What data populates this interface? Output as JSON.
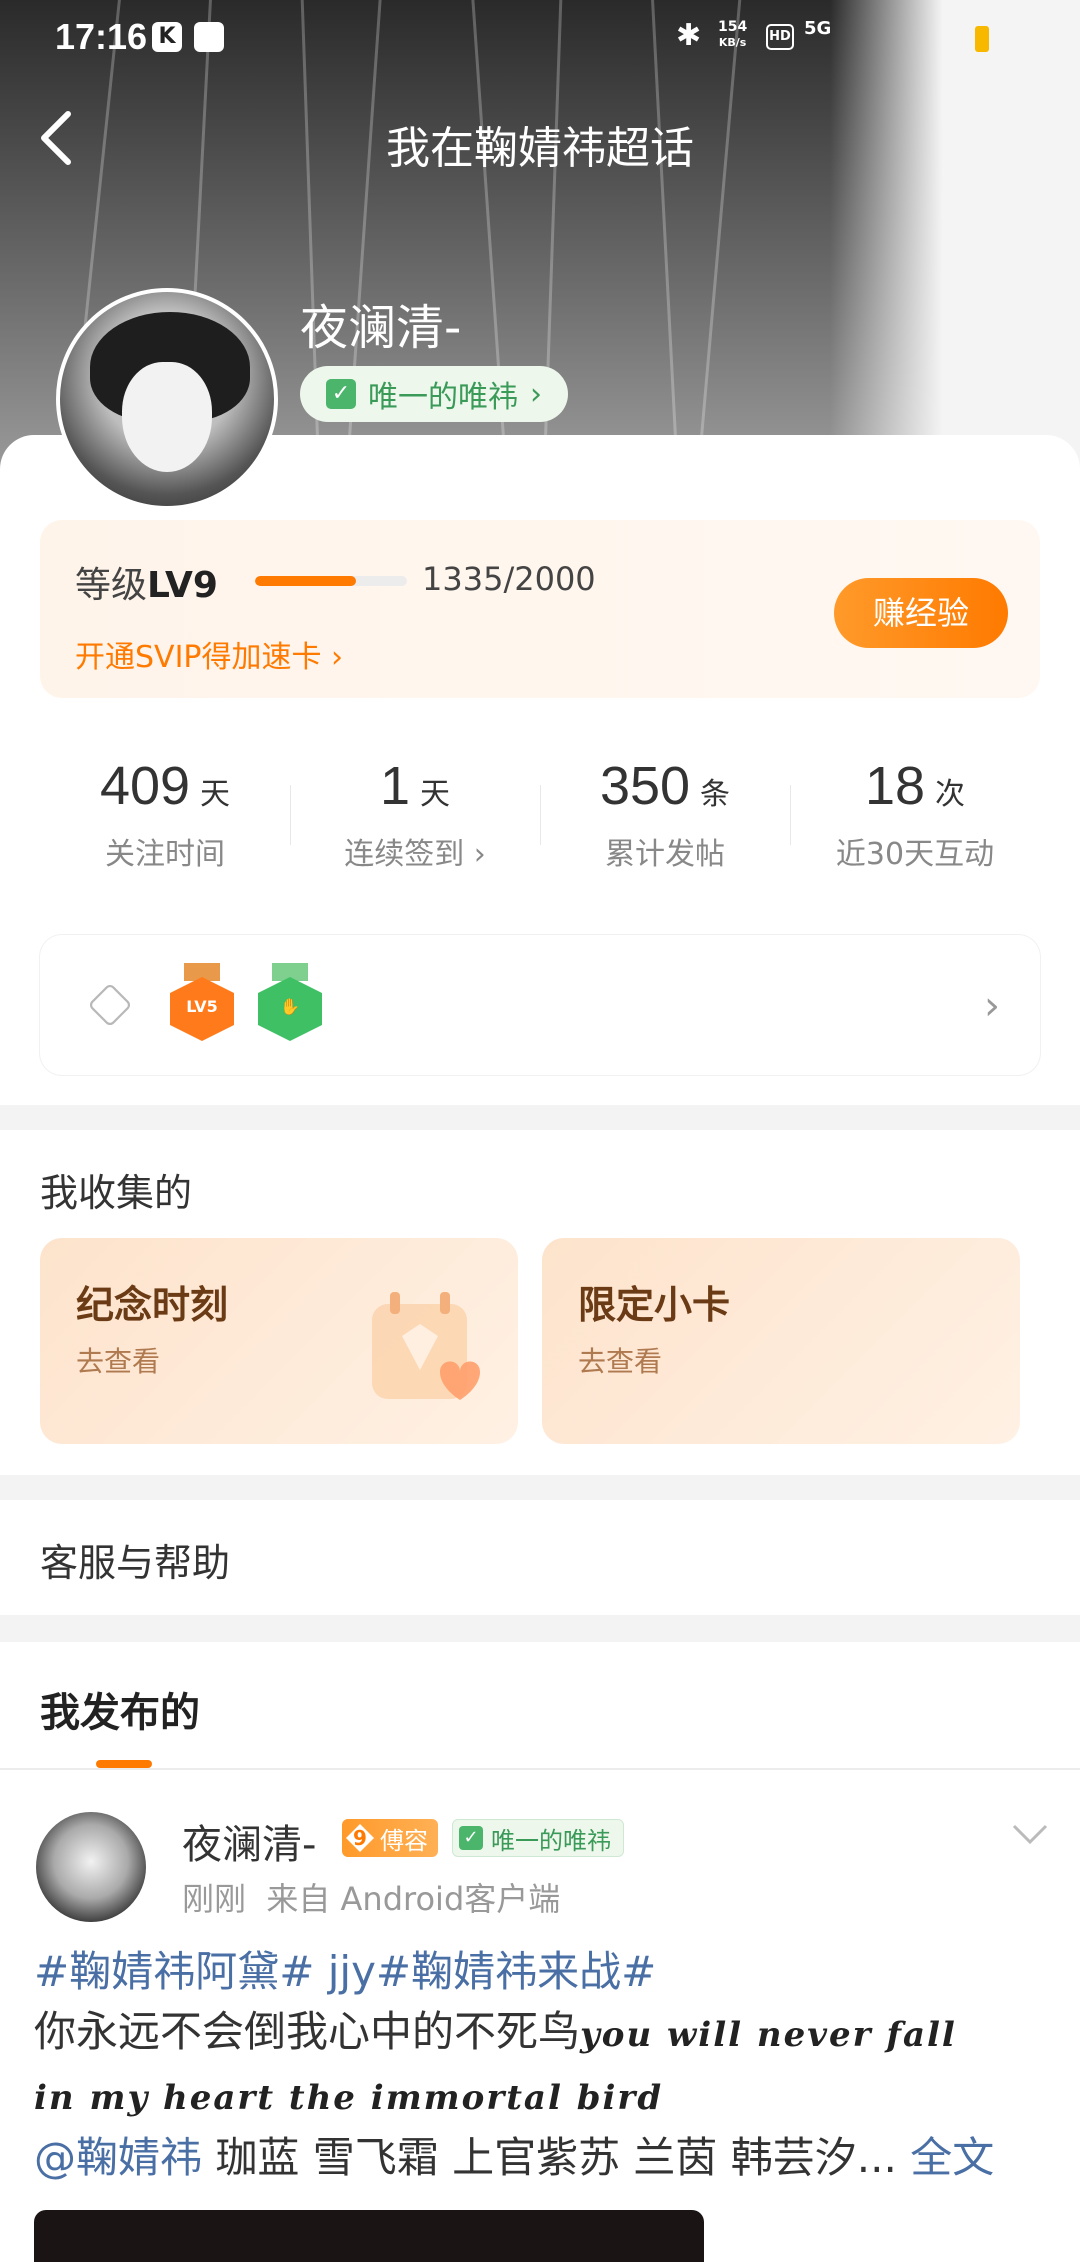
{
  "status_bar": {
    "time": "17:16",
    "network_speed_value": "154",
    "network_speed_unit": "KB/s",
    "hd_label": "HD",
    "signal_label": "5G"
  },
  "header": {
    "title": "我在鞠婧祎超话",
    "username": "夜澜清-",
    "badge_label": "唯一的唯祎"
  },
  "level": {
    "prefix": "等级",
    "value": "LV9",
    "progress_text": "1335/2000",
    "progress_fraction": 0.6675,
    "svip_link": "开通SVIP得加速卡 ›",
    "earn_button": "赚经验"
  },
  "stats": [
    {
      "value": "409",
      "unit": "天",
      "label": "关注时间"
    },
    {
      "value": "1",
      "unit": "天",
      "label": "连续签到 ›"
    },
    {
      "value": "350",
      "unit": "条",
      "label": "累计发帖"
    },
    {
      "value": "18",
      "unit": "次",
      "label": "近30天互动"
    }
  ],
  "medals": {
    "items": [
      {
        "name": "level-medal",
        "text": "LV5",
        "color": "#ff7a1a"
      },
      {
        "name": "interaction-medal",
        "text": "",
        "color": "#3fc065"
      }
    ]
  },
  "collections": {
    "title": "我收集的",
    "cards": [
      {
        "title": "纪念时刻",
        "subtitle": "去查看"
      },
      {
        "title": "限定小卡",
        "subtitle": "去查看"
      }
    ]
  },
  "help": {
    "title": "客服与帮助"
  },
  "posts": {
    "tab_title": "我发布的",
    "item": {
      "author": "夜澜清-",
      "fan_level": "9",
      "fan_title": "傅容",
      "cert_label": "唯一的唯祎",
      "time": "刚刚",
      "source": "来自 Android客户端",
      "tags": "#鞠婧祎阿黛# jjy#鞠婧祎来战#",
      "line1": "你永远不会倒我心中的不死鸟",
      "english1": "you will never fall",
      "english2": "in my heart the immortal bird",
      "mention": "@鞠婧祎",
      "names": " 珈蓝 雪飞霜 上官紫苏 兰茵 韩芸汐...",
      "more": "全文"
    }
  },
  "colors": {
    "accent": "#ff7a00",
    "link": "#4a6fa5",
    "green": "#4cb56c"
  }
}
